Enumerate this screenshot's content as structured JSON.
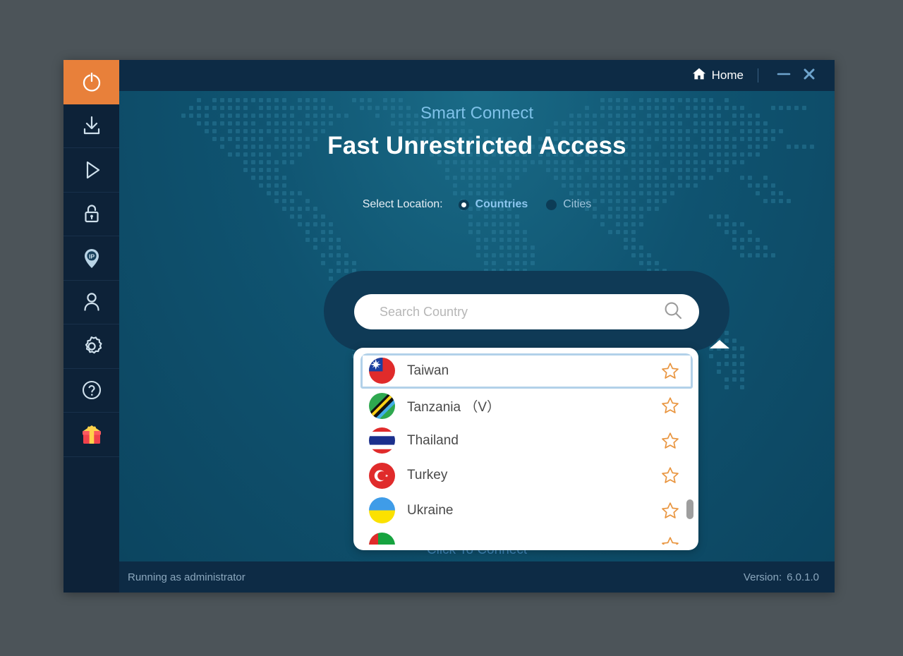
{
  "window": {
    "titlebar": {
      "home_label": "Home",
      "home_icon": "home-icon",
      "minimize_icon": "minimize-icon",
      "close_icon": "close-icon"
    },
    "statusbar": {
      "left_text": "Running as administrator",
      "version_label": "Version:",
      "version_value": "6.0.1.0"
    }
  },
  "sidebar": {
    "items": [
      {
        "icon": "power-icon",
        "name": "sidebar-item-power",
        "active": true
      },
      {
        "icon": "download-icon",
        "name": "sidebar-item-download",
        "active": false
      },
      {
        "icon": "play-icon",
        "name": "sidebar-item-play",
        "active": false
      },
      {
        "icon": "lock-icon",
        "name": "sidebar-item-lock",
        "active": false
      },
      {
        "icon": "ip-pin-icon",
        "name": "sidebar-item-ip",
        "active": false
      },
      {
        "icon": "user-icon",
        "name": "sidebar-item-account",
        "active": false
      },
      {
        "icon": "gear-icon",
        "name": "sidebar-item-settings",
        "active": false
      },
      {
        "icon": "help-icon",
        "name": "sidebar-item-help",
        "active": false
      },
      {
        "icon": "gift-icon",
        "name": "sidebar-item-gift",
        "active": false
      }
    ]
  },
  "main": {
    "subtitle": "Smart Connect",
    "headline": "Fast Unrestricted Access",
    "select_location_label": "Select Location:",
    "location_modes": [
      {
        "label": "Countries",
        "selected": true
      },
      {
        "label": "Cities",
        "selected": false
      }
    ],
    "search": {
      "placeholder": "Search Country",
      "value": "",
      "icon": "search-icon"
    },
    "connect_label": "Click To Connect"
  },
  "dropdown": {
    "rows": [
      {
        "name": "Taiwan",
        "flag": "taiwan-flag",
        "selected": true,
        "starred": false
      },
      {
        "name": "Tanzania （V）",
        "flag": "tanzania-flag",
        "selected": false,
        "starred": false
      },
      {
        "name": "Thailand",
        "flag": "thailand-flag",
        "selected": false,
        "starred": false
      },
      {
        "name": "Turkey",
        "flag": "turkey-flag",
        "selected": false,
        "starred": false
      },
      {
        "name": "Ukraine",
        "flag": "ukraine-flag",
        "selected": false,
        "starred": false
      },
      {
        "name": "",
        "flag": "uae-flag",
        "selected": false,
        "starred": false
      }
    ]
  },
  "colors": {
    "accent_orange": "#e8803a",
    "sidebar_dark": "#0d2238",
    "titlebar": "#0d2b45",
    "main_teal": "#10546f",
    "bubble": "#0f3a56",
    "selection_border": "#b2d1e9",
    "star_orange": "#e9953f",
    "subtitle_blue": "#7ec1e8",
    "desktop": "#4c5459"
  }
}
